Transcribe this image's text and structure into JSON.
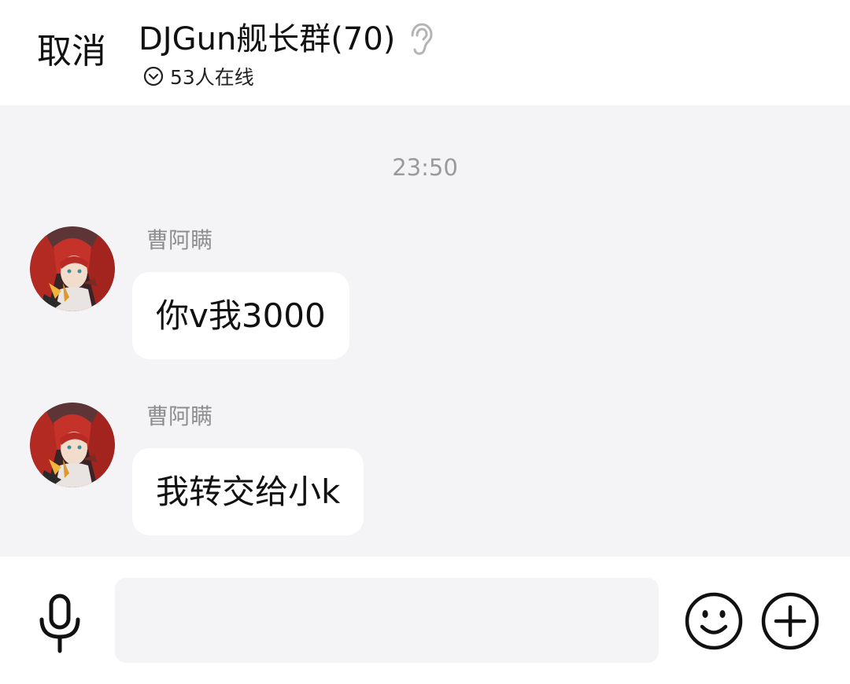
{
  "header": {
    "cancel_label": "取消",
    "group_title": "DJGun舰长群(70)",
    "online_status": "53人在线"
  },
  "chat": {
    "timestamp": "23:50",
    "messages": [
      {
        "sender": "曹阿瞒",
        "text": "你v我3000"
      },
      {
        "sender": "曹阿瞒",
        "text": "我转交给小k"
      }
    ]
  },
  "input_bar": {
    "input_value": "",
    "input_placeholder": ""
  },
  "icons": {
    "header_ear": "ear-icon",
    "online_toggle": "chevron-down-circle-icon",
    "voice": "microphone-icon",
    "emoji": "smiley-icon",
    "more": "plus-circle-icon"
  },
  "colors": {
    "chat_background": "#f4f3f5",
    "bubble_background": "#ffffff",
    "sender_name": "#8e8e8e",
    "timestamp": "#9a9a9a",
    "text_primary": "#111111"
  }
}
